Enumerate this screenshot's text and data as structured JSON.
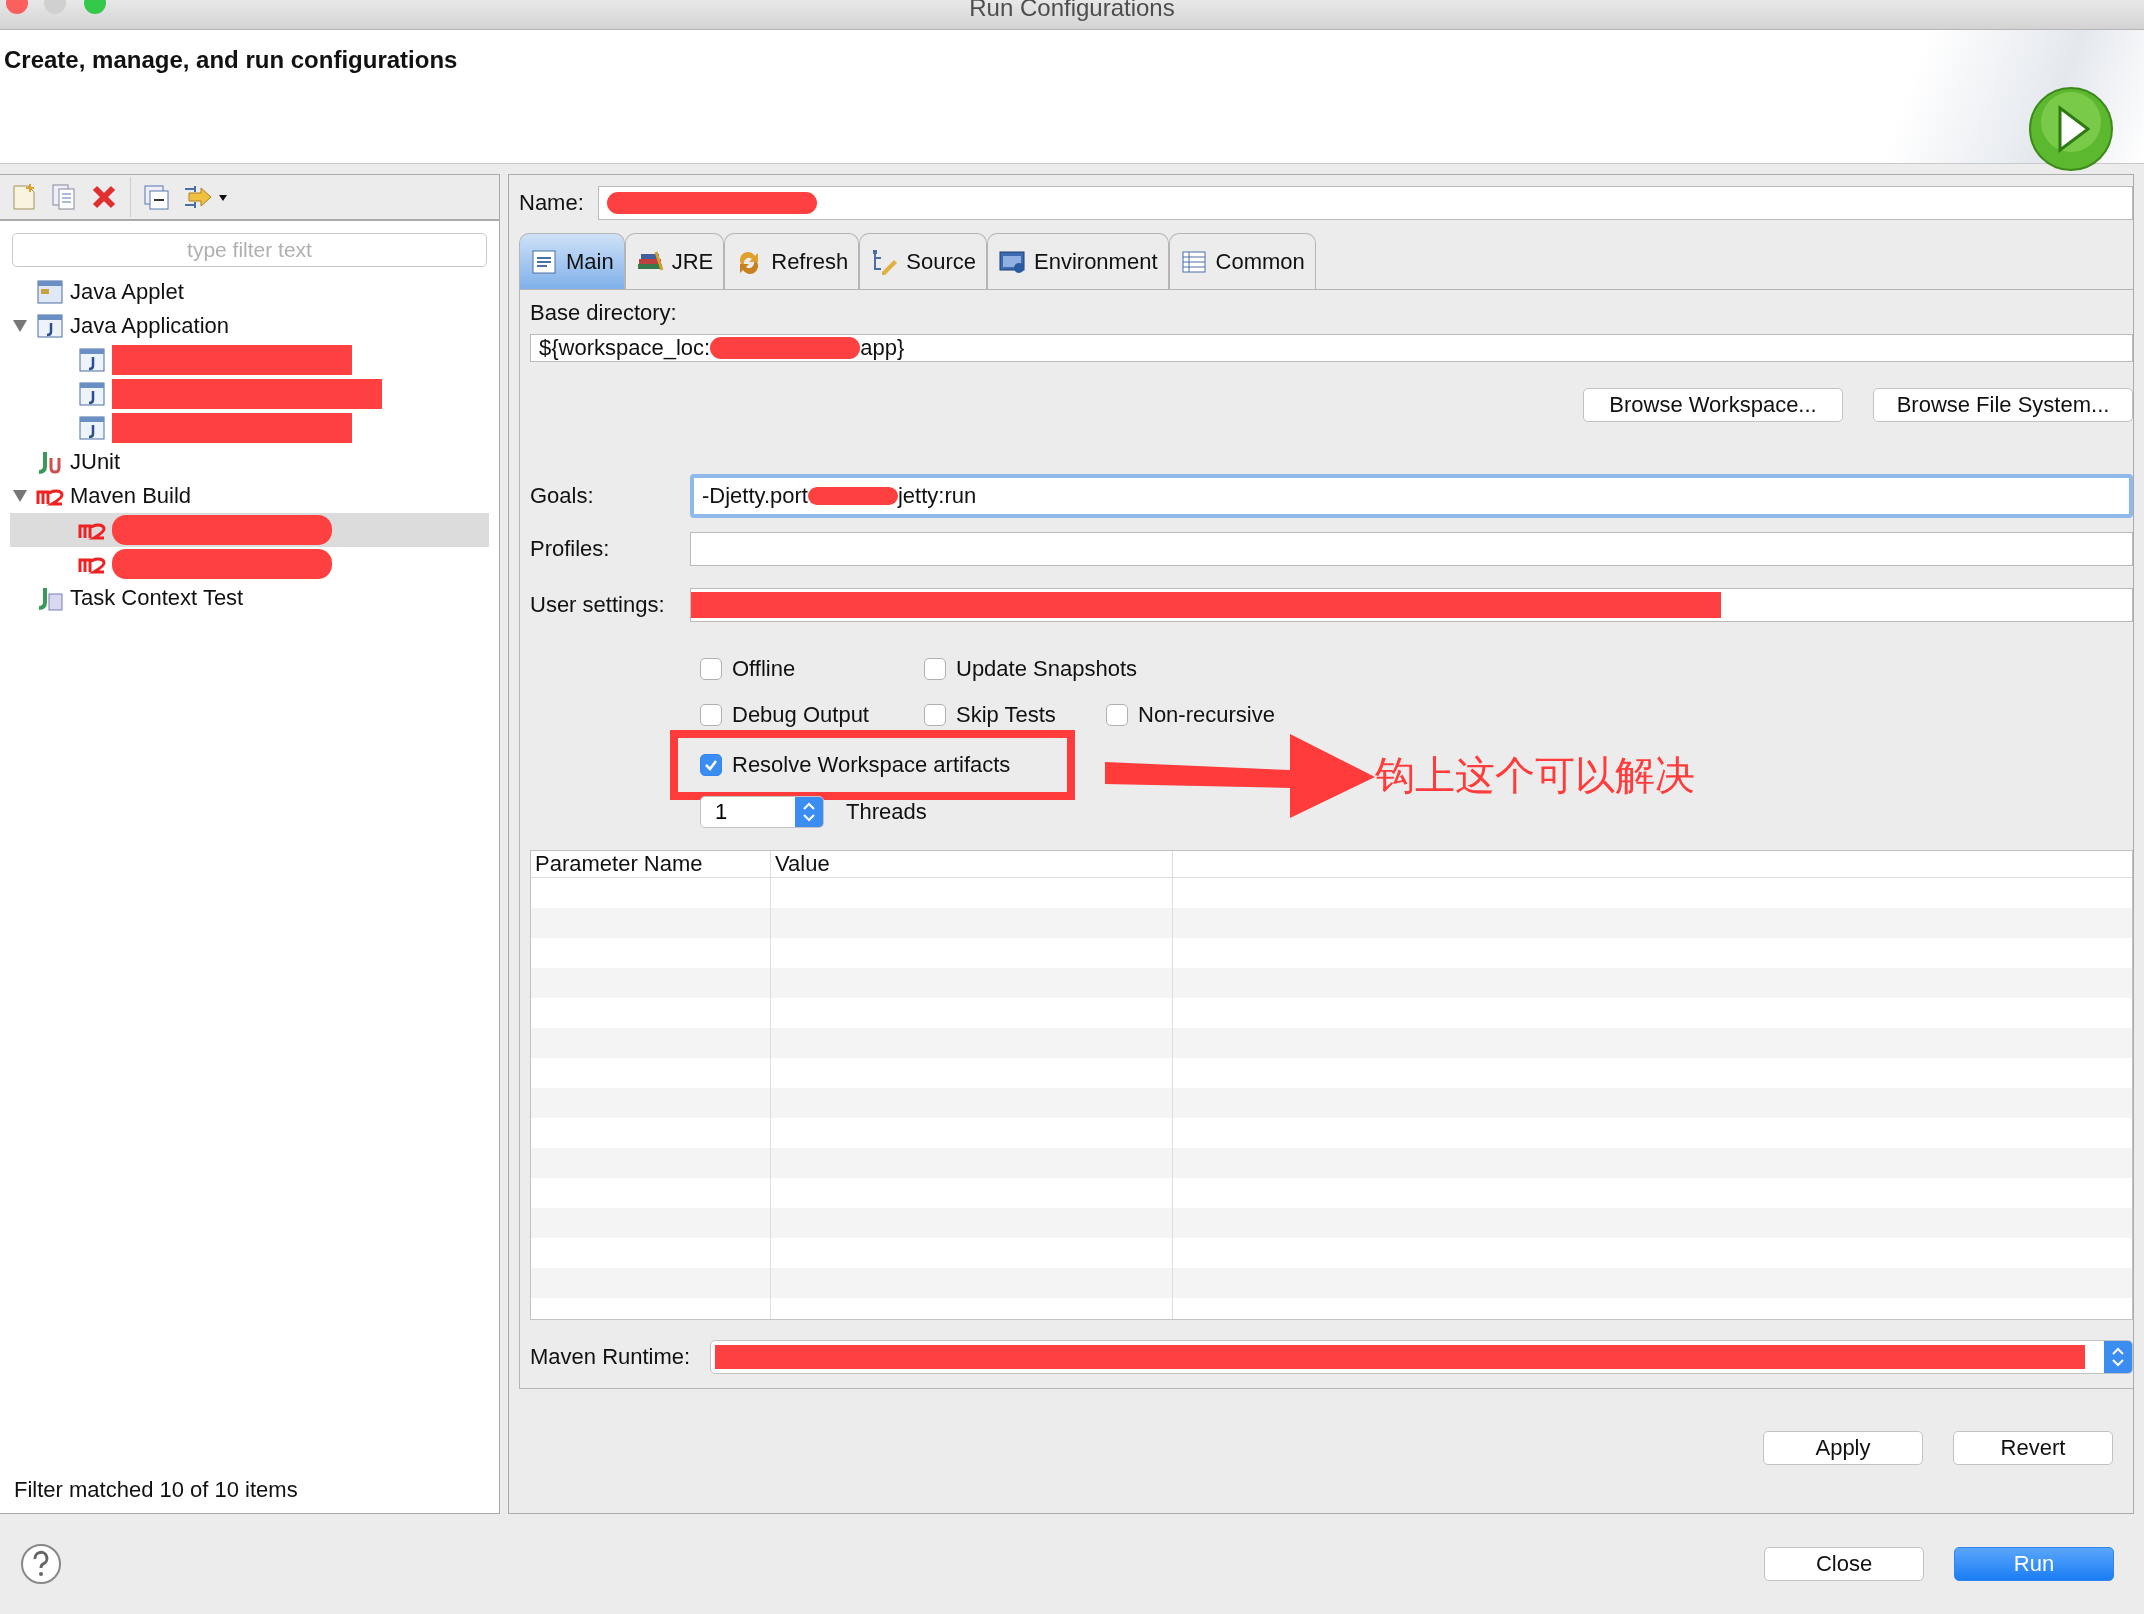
{
  "window": {
    "title": "Run Configurations"
  },
  "header": {
    "title": "Create, manage, and run configurations"
  },
  "sidebar": {
    "filter": {
      "placeholder": "type filter text"
    },
    "tree": [
      {
        "label": "Java Applet",
        "kind": "applet"
      },
      {
        "label": "Java Application",
        "kind": "java",
        "expanded": true,
        "children": [
          {
            "kind": "java",
            "selected": false
          },
          {
            "kind": "java",
            "selected": false
          },
          {
            "kind": "java",
            "selected": false
          }
        ]
      },
      {
        "label": "JUnit",
        "kind": "junit"
      },
      {
        "label": "Maven Build",
        "kind": "maven",
        "expanded": true,
        "children": [
          {
            "kind": "maven",
            "selected": true
          },
          {
            "kind": "maven",
            "selected": false
          }
        ]
      },
      {
        "label": "Task Context Test",
        "kind": "task"
      }
    ],
    "status": "Filter matched 10 of 10 items"
  },
  "config": {
    "name_label": "Name:",
    "tabs": [
      {
        "label": "Main",
        "kind": "main",
        "selected": true
      },
      {
        "label": "JRE",
        "kind": "jre",
        "selected": false
      },
      {
        "label": "Refresh",
        "kind": "refresh",
        "selected": false
      },
      {
        "label": "Source",
        "kind": "source",
        "selected": false
      },
      {
        "label": "Environment",
        "kind": "environment",
        "selected": false
      },
      {
        "label": "Common",
        "kind": "common",
        "selected": false
      }
    ],
    "base_directory": {
      "label": "Base directory:",
      "value_start": "${workspace_loc:",
      "value_end": "app}"
    },
    "browse_buttons": [
      "Browse Workspace...",
      "Browse File System..."
    ],
    "goals": {
      "label": "Goals:",
      "value_start": "-Djetty.port",
      "value_end": "jetty:run",
      "focused": true
    },
    "profiles": {
      "label": "Profiles:"
    },
    "user_settings": {
      "label": "User settings:"
    },
    "options": [
      [
        {
          "label": "Offline",
          "checked": false,
          "highlighted": false
        },
        {
          "label": "Update Snapshots",
          "checked": false,
          "highlighted": false
        }
      ],
      [
        {
          "label": "Debug Output",
          "checked": false,
          "highlighted": false
        },
        {
          "label": "Skip Tests",
          "checked": false,
          "highlighted": false
        },
        {
          "label": "Non-recursive",
          "checked": false,
          "highlighted": false
        }
      ],
      [
        {
          "label": "Resolve Workspace artifacts",
          "checked": true,
          "highlighted": true
        }
      ]
    ],
    "annotation": {
      "text": "钩上这个可以解决"
    },
    "threads": {
      "value": "1",
      "label": "Threads"
    },
    "parameters": {
      "columns": [
        "Parameter Name",
        "Value"
      ]
    },
    "maven_runtime": {
      "label": "Maven Runtime:"
    },
    "actions": [
      "Apply",
      "Revert"
    ]
  },
  "footer": {
    "buttons": [
      {
        "label": "Close",
        "primary": false
      },
      {
        "label": "Run",
        "primary": true
      }
    ]
  }
}
